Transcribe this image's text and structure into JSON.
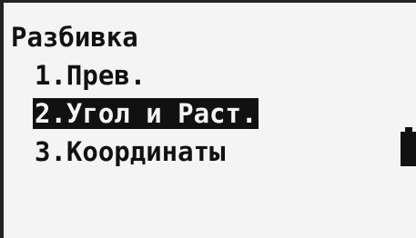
{
  "screen": {
    "title": "Разбивка",
    "menu": {
      "items": [
        {
          "label": "1.Прев."
        },
        {
          "label": "2.Угол и Раст.",
          "selected": true
        },
        {
          "label": "3.Координаты"
        }
      ]
    },
    "battery_icon": "battery-icon"
  }
}
